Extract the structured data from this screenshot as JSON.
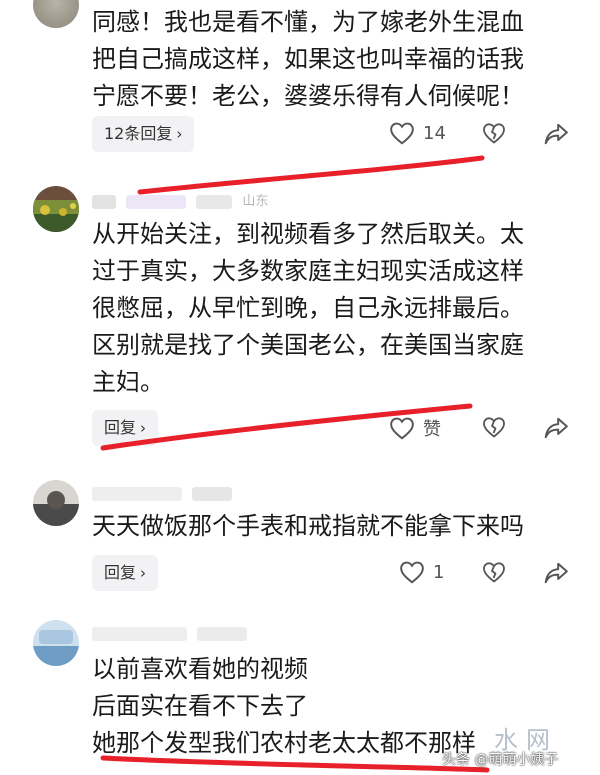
{
  "comments": [
    {
      "lines": [
        "同感！我也是看不懂，为了嫁老外生混血",
        "把自己搞成这样，如果这也叫幸福的话我",
        "宁愿不要！老公，婆婆乐得有人伺候呢！"
      ],
      "reply_label": "12条回复",
      "like_count": "14"
    },
    {
      "location": "山东",
      "lines": [
        "从开始关注，到视频看多了然后取关。太",
        "过于真实，大多数家庭主妇现实活成这样",
        "很憋屈，从早忙到晚，自己永远排最后。",
        "区别就是找了个美国老公，在美国当家庭",
        "主妇。"
      ],
      "reply_label": "回复",
      "like_label": "赞"
    },
    {
      "lines": [
        "天天做饭那个手表和戒指就不能拿下来吗"
      ],
      "reply_label": "回复",
      "like_count": "1"
    },
    {
      "lines": [
        "以前喜欢看她的视频",
        "后面实在看不下去了",
        "她那个发型我们农村老太太都不那样"
      ]
    }
  ],
  "watermark": {
    "account": "头条 @萌萌小姨子",
    "site": "水网"
  },
  "colors": {
    "annotation_red": "#e8202a",
    "action_icon": "#555555"
  }
}
